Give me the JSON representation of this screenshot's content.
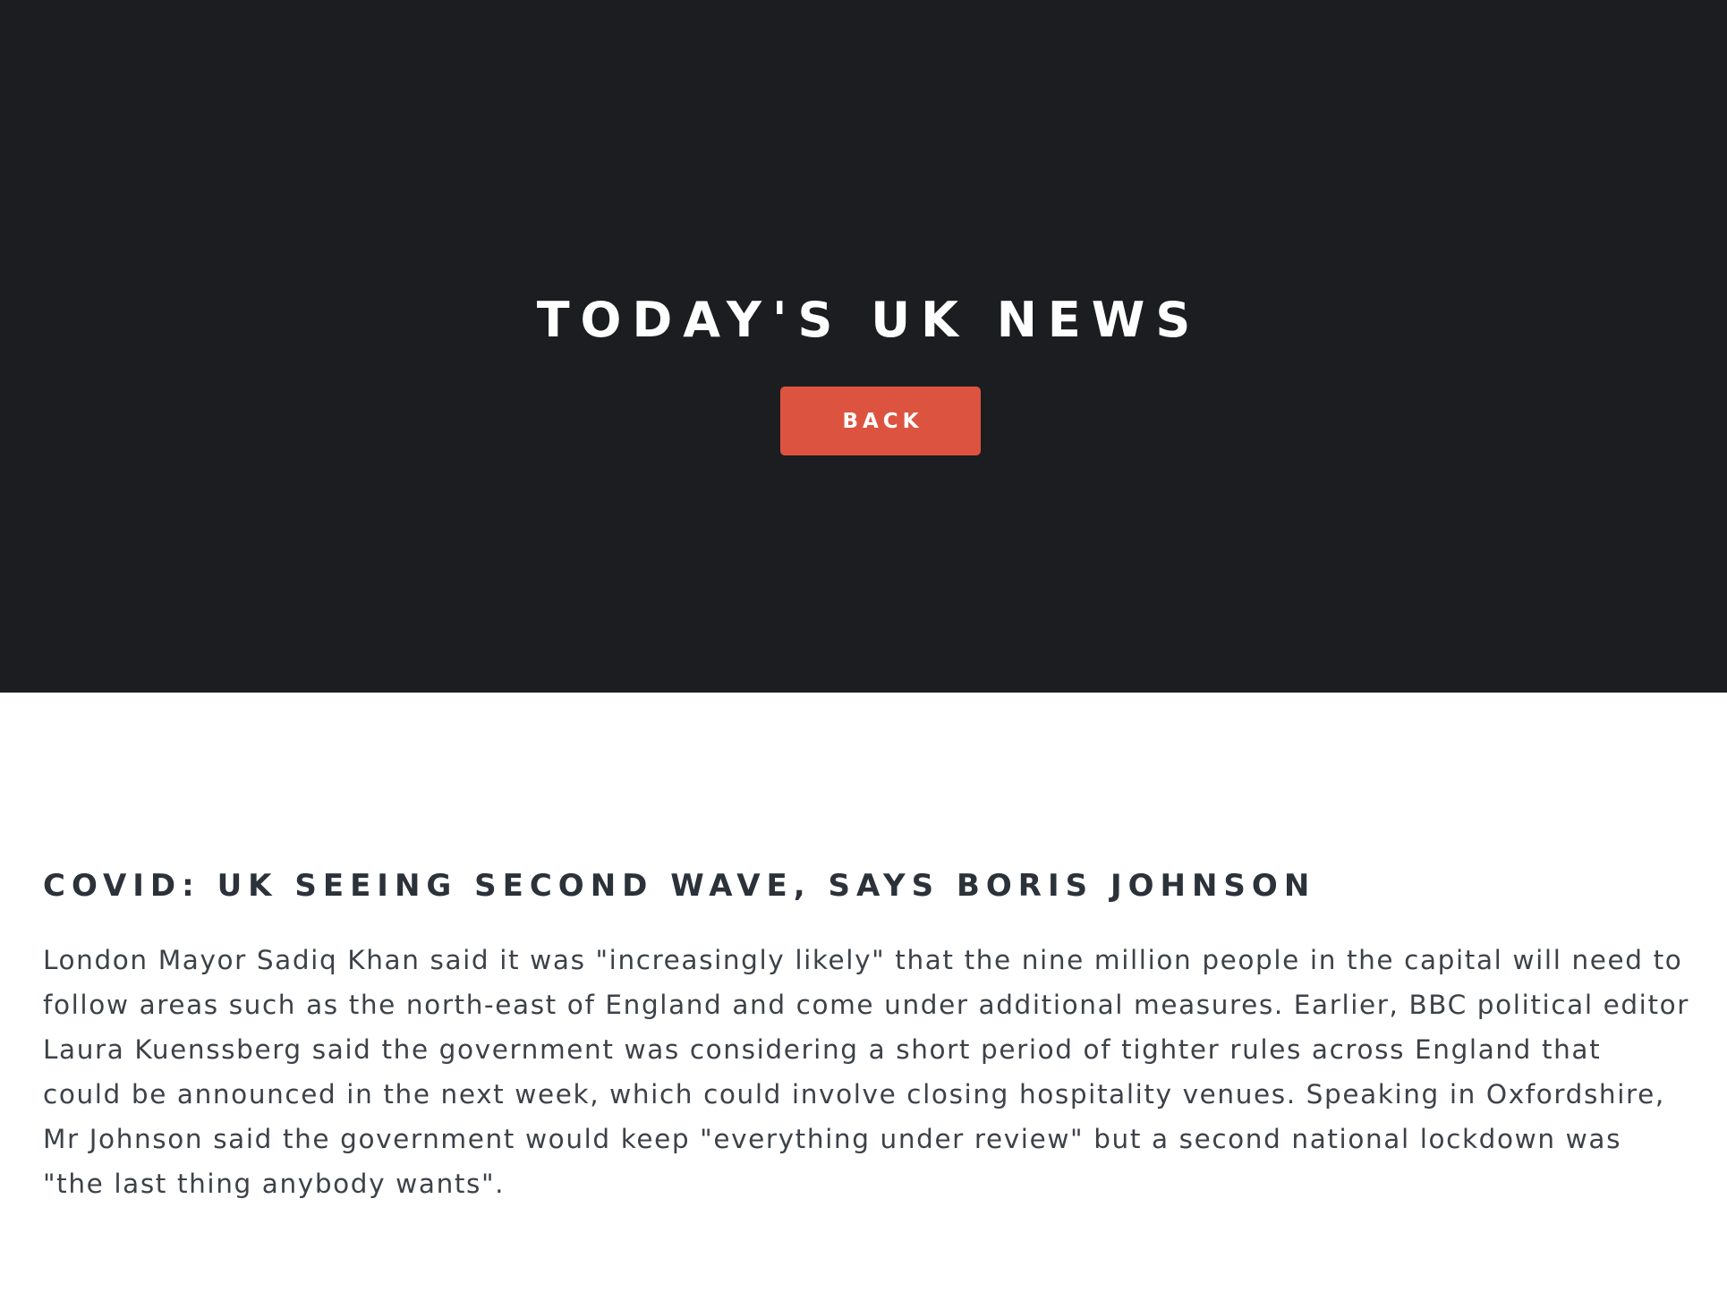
{
  "hero": {
    "title": "TODAY'S UK NEWS",
    "back_label": "BACK",
    "background_color": "#1b1d20",
    "button_color": "#dc5440"
  },
  "article": {
    "title": "COVID: UK SEEING SECOND WAVE, SAYS BORIS JOHNSON",
    "body": "London Mayor Sadiq Khan said it was \"increasingly likely\" that the nine million people in the capital will need to follow areas such as the north-east of England and come under additional measures. Earlier, BBC political editor Laura Kuenssberg said the government was considering a short period of tighter rules across England that could be announced in the next week, which could involve closing hospitality venues. Speaking in Oxfordshire, Mr Johnson said the government would keep \"everything under review\" but a second national lockdown was \"the last thing anybody wants\"."
  }
}
